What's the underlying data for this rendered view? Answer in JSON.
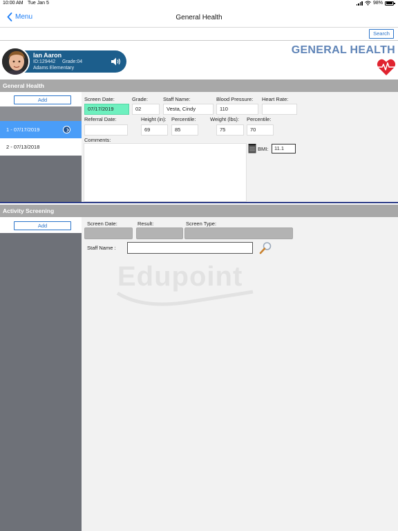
{
  "status_bar": {
    "time": "10:00 AM",
    "date": "Tue Jan 5",
    "battery": "98%"
  },
  "nav": {
    "back_label": "Menu",
    "title": "General Health"
  },
  "search_label": "Search",
  "student": {
    "name": "Ian Aaron",
    "id": "ID:129442",
    "grade": "Grade:04",
    "school": "Adams Elementary"
  },
  "module_title": "GENERAL HEALTH",
  "general_health": {
    "section_title": "General Health",
    "add_label": "Add",
    "records": [
      {
        "label": "1 - 07/17/2019",
        "selected": true
      },
      {
        "label": "2 - 07/13/2018",
        "selected": false
      }
    ],
    "fields": {
      "screen_date_label": "Screen Date:",
      "screen_date": "07/17/2019",
      "grade_label": "Grade:",
      "grade": "02",
      "staff_name_label": "Staff Name:",
      "staff_name": "Vesta, Cindy",
      "blood_pressure_label": "Blood Pressure:",
      "blood_pressure": "110",
      "heart_rate_label": "Heart Rate:",
      "heart_rate": "",
      "referral_date_label": "Referral Date:",
      "referral_date": "",
      "height_label": "Height (in):",
      "height": "69",
      "height_percentile_label": "Percentile:",
      "height_percentile": "85",
      "weight_label": "Weight (lbs):",
      "weight": "75",
      "weight_percentile_label": "Percentile:",
      "weight_percentile": "70",
      "comments_label": "Comments:",
      "comments": "",
      "bmi_label": "BMI:",
      "bmi": "11.1"
    }
  },
  "activity_screening": {
    "section_title": "Activity Screening",
    "add_label": "Add",
    "screen_date_label": "Screen Date:",
    "result_label": "Result:",
    "screen_type_label": "Screen Type:",
    "staff_name_label": "Staff Name :",
    "staff_name": ""
  },
  "watermark": "Edupoint",
  "colors": {
    "accent_blue": "#1a7cf6",
    "student_pill": "#1c5e8c",
    "selected_row": "#4a9df8",
    "screen_date_highlight": "#6ef0bf",
    "module_title": "#5f84b7",
    "heart": "#e0232f"
  },
  "icons": [
    "chevron-left-icon",
    "signal-icon",
    "wifi-icon",
    "battery-icon",
    "speaker-icon",
    "heart-pulse-icon",
    "chevron-right-circle-icon",
    "notepad-icon",
    "magnifier-icon"
  ]
}
